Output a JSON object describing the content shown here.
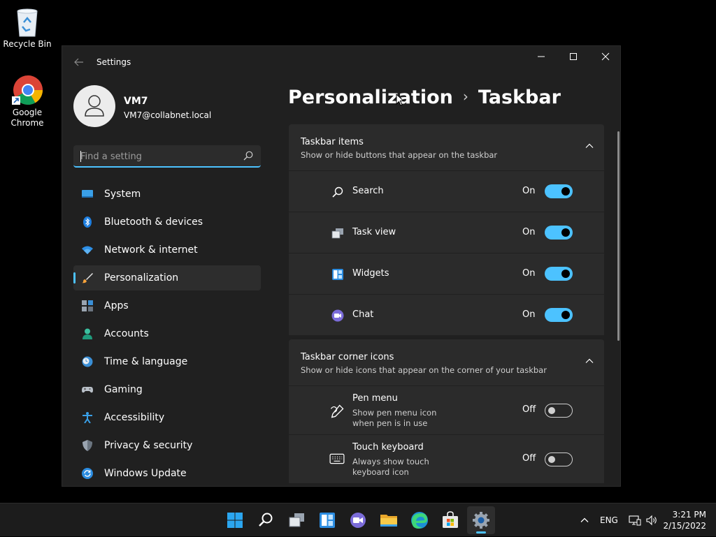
{
  "desktop": {
    "icons": [
      {
        "label": "Recycle Bin"
      },
      {
        "label": "Google Chrome"
      }
    ]
  },
  "window": {
    "title": "Settings",
    "controls": {
      "minimize": "─",
      "maximize": "☐",
      "close": "✕"
    }
  },
  "profile": {
    "name": "VM7",
    "email": "VM7@collabnet.local"
  },
  "search": {
    "placeholder": "Find a setting"
  },
  "sidebar": {
    "items": [
      {
        "label": "System",
        "icon": "system-icon"
      },
      {
        "label": "Bluetooth & devices",
        "icon": "bluetooth-icon"
      },
      {
        "label": "Network & internet",
        "icon": "wifi-icon"
      },
      {
        "label": "Personalization",
        "icon": "brush-icon",
        "active": true
      },
      {
        "label": "Apps",
        "icon": "apps-icon"
      },
      {
        "label": "Accounts",
        "icon": "accounts-icon"
      },
      {
        "label": "Time & language",
        "icon": "clock-globe-icon"
      },
      {
        "label": "Gaming",
        "icon": "gamepad-icon"
      },
      {
        "label": "Accessibility",
        "icon": "accessibility-icon"
      },
      {
        "label": "Privacy & security",
        "icon": "shield-icon"
      },
      {
        "label": "Windows Update",
        "icon": "update-icon"
      }
    ]
  },
  "breadcrumb": {
    "parent": "Personalization",
    "separator": "›",
    "current": "Taskbar"
  },
  "taskbar_items": {
    "title": "Taskbar items",
    "subtitle": "Show or hide buttons that appear on the taskbar",
    "rows": [
      {
        "label": "Search",
        "state": "On"
      },
      {
        "label": "Task view",
        "state": "On"
      },
      {
        "label": "Widgets",
        "state": "On"
      },
      {
        "label": "Chat",
        "state": "On"
      }
    ]
  },
  "corner_icons": {
    "title": "Taskbar corner icons",
    "subtitle": "Show or hide icons that appear on the corner of your taskbar",
    "rows": [
      {
        "label": "Pen menu",
        "desc": "Show pen menu icon when pen is in use",
        "state": "Off"
      },
      {
        "label": "Touch keyboard",
        "desc": "Always show touch keyboard icon",
        "state": "Off"
      }
    ]
  },
  "tray": {
    "language": "ENG",
    "time": "3:21 PM",
    "date": "2/15/2022"
  },
  "colors": {
    "accent": "#4cc2ff",
    "window_bg": "#202020",
    "card_bg": "#2b2b2b"
  }
}
